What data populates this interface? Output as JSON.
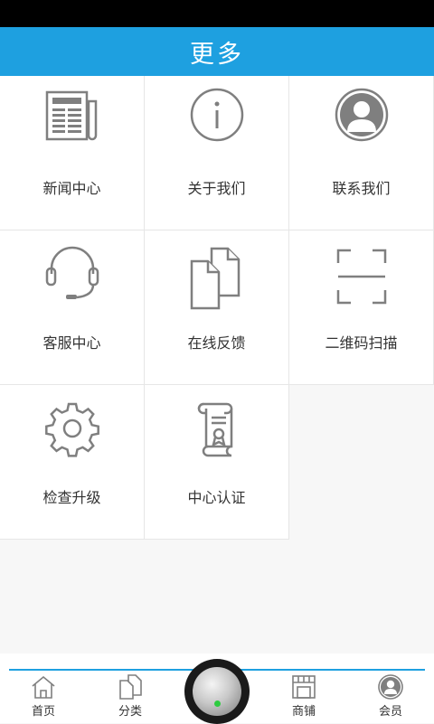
{
  "header": {
    "title": "更多"
  },
  "grid": {
    "items": [
      {
        "label": "新闻中心",
        "icon": "news-icon"
      },
      {
        "label": "关于我们",
        "icon": "info-icon"
      },
      {
        "label": "联系我们",
        "icon": "contact-person-icon"
      },
      {
        "label": "客服中心",
        "icon": "headset-icon"
      },
      {
        "label": "在线反馈",
        "icon": "documents-icon"
      },
      {
        "label": "二维码扫描",
        "icon": "scan-frame-icon"
      },
      {
        "label": "检查升级",
        "icon": "gear-icon"
      },
      {
        "label": "中心认证",
        "icon": "certificate-scroll-icon"
      }
    ]
  },
  "tabbar": {
    "items": [
      {
        "label": "首页",
        "icon": "home-icon"
      },
      {
        "label": "分类",
        "icon": "category-icon"
      },
      {
        "label": "商铺",
        "icon": "shop-icon"
      },
      {
        "label": "会员",
        "icon": "member-icon"
      }
    ],
    "center_button": "center-menu-button"
  },
  "colors": {
    "accent": "#1ea0e0",
    "icon_gray": "#7f7f7f",
    "status_bar": "#000000",
    "indicator": "#2ecc40"
  }
}
